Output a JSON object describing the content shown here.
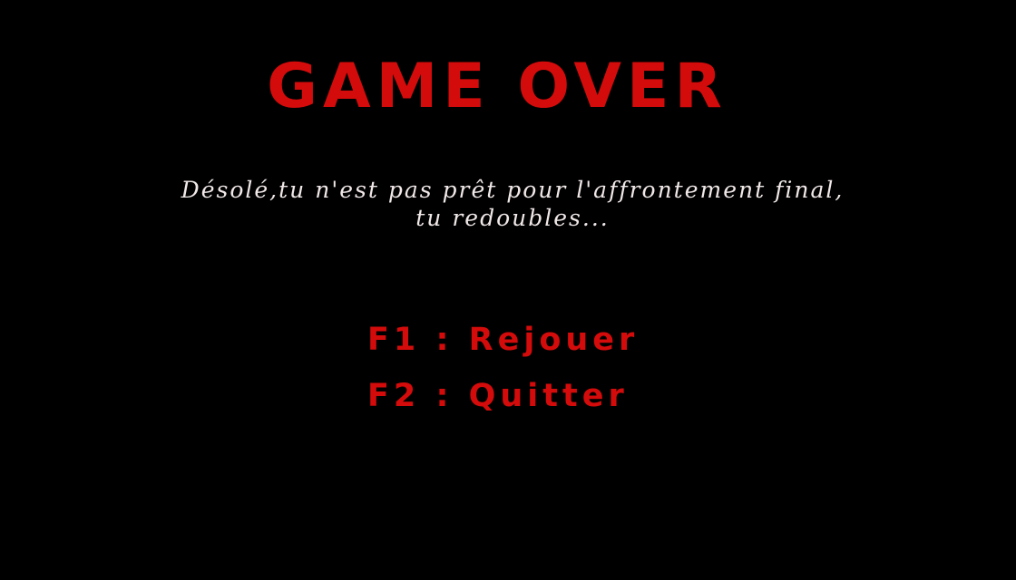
{
  "title": "GAME OVER",
  "message": {
    "line1": "Désolé,tu n'est pas prêt pour l'affrontement final,",
    "line2": "tu redoubles..."
  },
  "menu": [
    {
      "key": "F1",
      "separator": ":",
      "label": "Rejouer"
    },
    {
      "key": "F2",
      "separator": ":",
      "label": "Quitter"
    }
  ],
  "colors": {
    "background": "#000000",
    "accent": "#d40b0b",
    "message": "#f1e8e8"
  }
}
